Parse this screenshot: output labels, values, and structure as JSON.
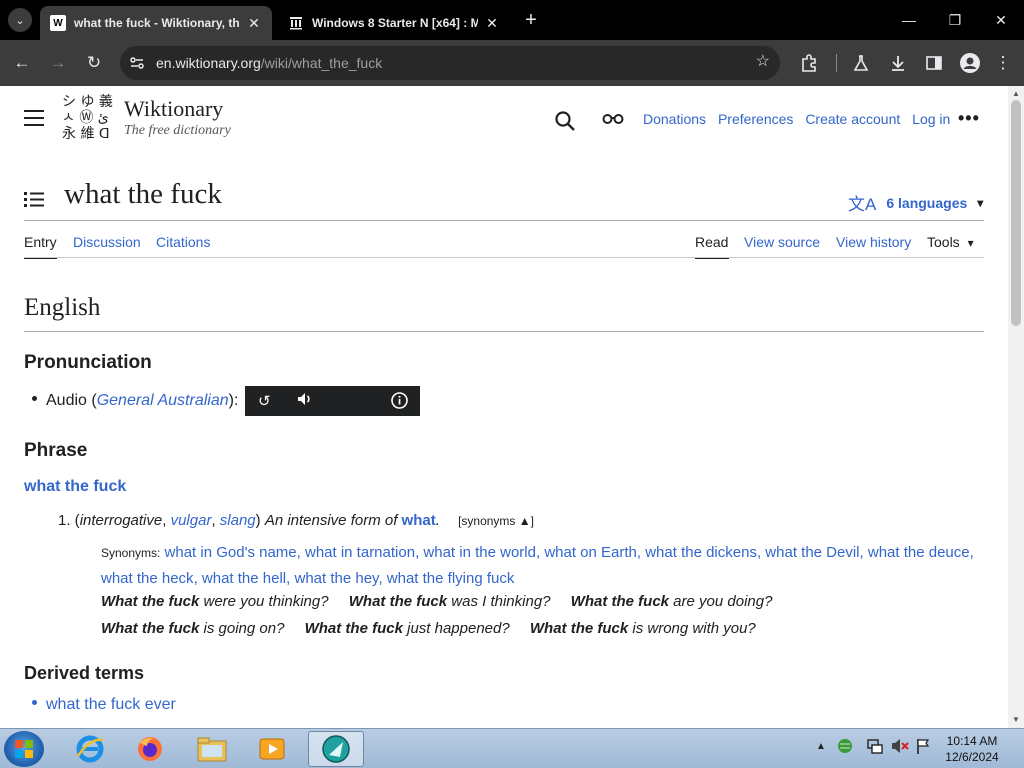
{
  "browser": {
    "tabs": [
      {
        "title": "what the fuck - Wiktionary, the",
        "favicon": "W",
        "active": true
      },
      {
        "title": "Windows 8 Starter N [x64] : M",
        "favicon": "archive-icon",
        "active": false
      }
    ],
    "url_host": "en.wiktionary.org",
    "url_path": "/wiki/what_the_fuck"
  },
  "site": {
    "name": "Wiktionary",
    "tagline": "The free dictionary",
    "header_links": [
      "Donations",
      "Preferences",
      "Create account",
      "Log in"
    ]
  },
  "page": {
    "title": "what the fuck",
    "languages": "6 languages",
    "left_tabs": [
      "Entry",
      "Discussion",
      "Citations"
    ],
    "right_tabs": [
      "Read",
      "View source",
      "View history"
    ],
    "tools": "Tools",
    "language_heading": "English",
    "pronunciation_heading": "Pronunciation",
    "audio_label": "Audio",
    "audio_variant": "General Australian",
    "phrase_heading": "Phrase",
    "headword": "what the fuck",
    "definition": {
      "number": "1.",
      "label1": "interrogative",
      "label2": "vulgar",
      "label3": "slang",
      "text": "An intensive form of",
      "link": "what",
      "toggle": "[synonyms ▲]"
    },
    "synonyms_label": "Synonyms:",
    "synonyms": [
      "what in God's name",
      "what in tarnation",
      "what in the world",
      "what on Earth",
      "what the dickens",
      "what the Devil",
      "what the deuce",
      "what the heck",
      "what the hell",
      "what the hey",
      "what the flying fuck"
    ],
    "examples_row1": [
      {
        "bold": "What the fuck",
        "rest": " were you thinking?"
      },
      {
        "bold": "What the fuck",
        "rest": " was I thinking?"
      },
      {
        "bold": "What the fuck",
        "rest": " are you doing?"
      }
    ],
    "examples_row2": [
      {
        "bold": "What the fuck",
        "rest": " is going on?"
      },
      {
        "bold": "What the fuck",
        "rest": " just happened?"
      },
      {
        "bold": "What the fuck",
        "rest": " is wrong with you?"
      }
    ],
    "derived_heading": "Derived terms",
    "derived_terms": [
      "what the fuck ever"
    ]
  },
  "taskbar": {
    "time": "10:14 AM",
    "date": "12/6/2024"
  }
}
